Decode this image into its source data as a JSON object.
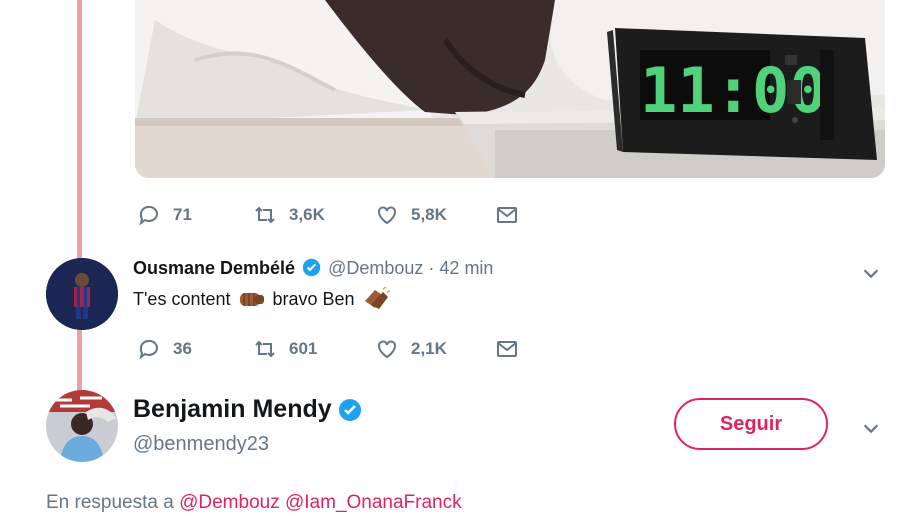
{
  "media": {
    "clock_display": "11:00",
    "colors": {
      "sheet": "#f1efec",
      "nightstand": "#dcdad6",
      "clock_body": "#1c1c1c",
      "digits": "#4fd27a"
    }
  },
  "original_tweet": {
    "actions": {
      "replies": "71",
      "retweets": "3,6K",
      "likes": "5,8K"
    }
  },
  "reply": {
    "name": "Ousmane Dembélé",
    "handle": "@Dembouz",
    "time": "· 42 min",
    "text_part1": "T'es content",
    "text_part2": "bravo Ben",
    "emoji1": "fist-bump-emoji",
    "emoji2": "clapping-hands-emoji",
    "actions": {
      "replies": "36",
      "retweets": "601",
      "likes": "2,1K"
    }
  },
  "profile": {
    "name": "Benjamin Mendy",
    "handle": "@benmendy23",
    "follow_label": "Seguir"
  },
  "reply_context": {
    "prefix": "En respuesta a",
    "mention1": "@Dembouz",
    "mention2": "@Iam_OnanaFranck"
  },
  "theme": {
    "accent": "#e0245e",
    "muted": "#657786",
    "verified": "#1da1f2",
    "thread_line": "#e8a3a8"
  }
}
